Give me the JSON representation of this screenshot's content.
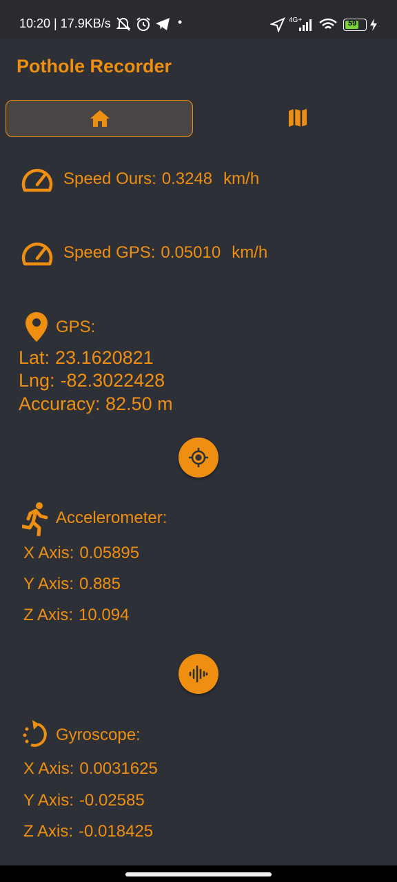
{
  "status_bar": {
    "time_speed": "10:20 | 17.9KB/s",
    "network": "4G+",
    "battery": "59"
  },
  "app": {
    "title": "Pothole Recorder"
  },
  "tabs": [
    {
      "icon": "home-icon",
      "selected": true
    },
    {
      "icon": "map-icon",
      "selected": false
    }
  ],
  "speed_ours": {
    "label": "Speed Ours:",
    "value": "0.3248",
    "unit": "km/h"
  },
  "speed_gps": {
    "label": "Speed GPS:",
    "value": "0.05010",
    "unit": "km/h"
  },
  "gps": {
    "heading": "GPS:",
    "lat_label": "Lat:",
    "lat": "23.1620821",
    "lng_label": "Lng:",
    "lng": "-82.3022428",
    "accuracy": "Accuracy: 82.50 m"
  },
  "accelerometer": {
    "heading": "Accelerometer:",
    "x_label": "X Axis:",
    "x": "0.05895",
    "y_label": "Y Axis:",
    "y": "0.885",
    "z_label": "Z Axis:",
    "z": "10.094"
  },
  "gyroscope": {
    "heading": "Gyroscope:",
    "x_label": "X Axis:",
    "x": "0.0031625",
    "y_label": "Y Axis:",
    "y": "-0.02585",
    "z_label": "Z Axis:",
    "z": "-0.018425"
  },
  "colors": {
    "accent": "#ee8f12",
    "background": "#2e3038",
    "tab_selected": "#4a4544"
  }
}
